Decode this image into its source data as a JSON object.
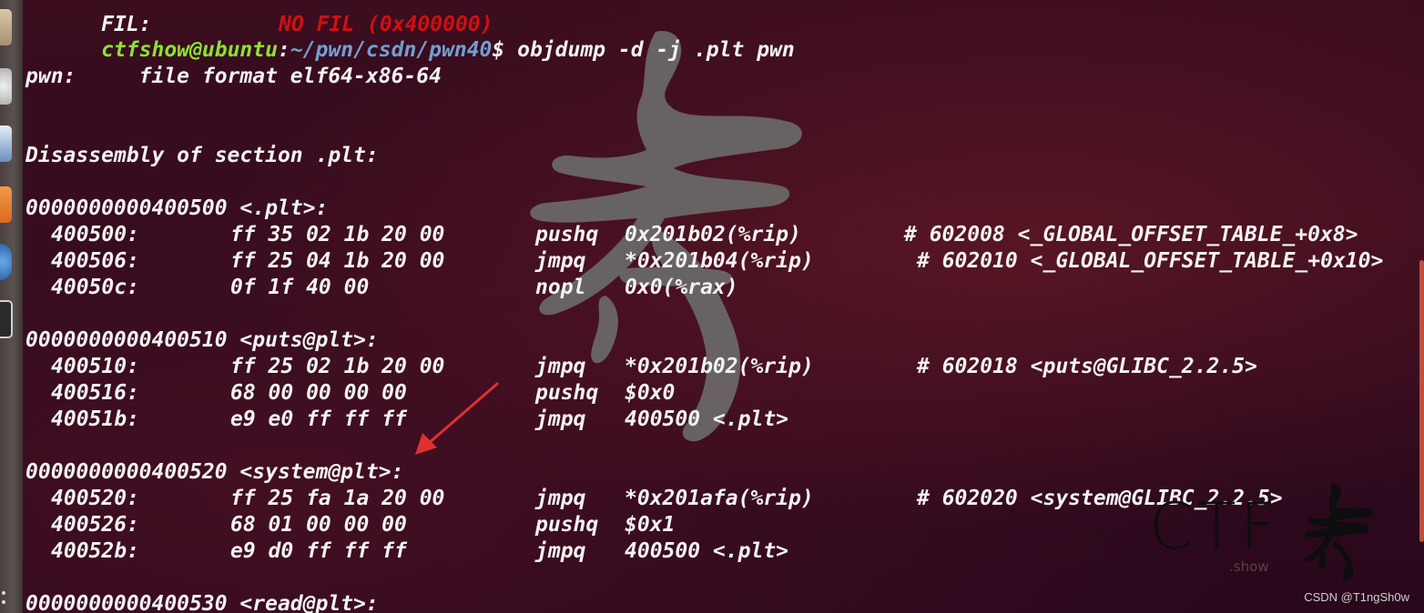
{
  "launcher": {
    "icons": [
      "files-icon",
      "browser-icon",
      "document-icon",
      "software-center-icon",
      "help-icon",
      "terminal-icon"
    ]
  },
  "terminal": {
    "cut_top_line": {
      "label": "FIL:",
      "value": "NO FIL (0x400000)"
    },
    "prompt": {
      "user_host": "ctfshow@ubuntu",
      "separator": ":",
      "path": "~/pwn/csdn/pwn40",
      "symbol": "$",
      "command": " objdump -d -j .plt pwn"
    },
    "file_line": "pwn:     file format elf64-x86-64",
    "section_header": "Disassembly of section .plt:",
    "blocks": [
      {
        "label": "0000000000400500 <.plt>:",
        "rows": [
          {
            "addr": "400500:",
            "bytes": "ff 35 02 1b 20 00",
            "mnemonic": "pushq",
            "operand": "0x201b02(%rip)",
            "comment": "# 602008 <_GLOBAL_OFFSET_TABLE_+0x8>"
          },
          {
            "addr": "400506:",
            "bytes": "ff 25 04 1b 20 00",
            "mnemonic": "jmpq",
            "operand": "*0x201b04(%rip)",
            "comment": "# 602010 <_GLOBAL_OFFSET_TABLE_+0x10>"
          },
          {
            "addr": "40050c:",
            "bytes": "0f 1f 40 00",
            "mnemonic": "nopl",
            "operand": "0x0(%rax)",
            "comment": ""
          }
        ]
      },
      {
        "label": "0000000000400510 <puts@plt>:",
        "rows": [
          {
            "addr": "400510:",
            "bytes": "ff 25 02 1b 20 00",
            "mnemonic": "jmpq",
            "operand": "*0x201b02(%rip)",
            "comment": "# 602018 <puts@GLIBC_2.2.5>"
          },
          {
            "addr": "400516:",
            "bytes": "68 00 00 00 00",
            "mnemonic": "pushq",
            "operand": "$0x0",
            "comment": ""
          },
          {
            "addr": "40051b:",
            "bytes": "e9 e0 ff ff ff",
            "mnemonic": "jmpq",
            "operand": "400500 <.plt>",
            "comment": ""
          }
        ]
      },
      {
        "label": "0000000000400520 <system@plt>:",
        "rows": [
          {
            "addr": "400520:",
            "bytes": "ff 25 fa 1a 20 00",
            "mnemonic": "jmpq",
            "operand": "*0x201afa(%rip)",
            "comment": "# 602020 <system@GLIBC_2.2.5>"
          },
          {
            "addr": "400526:",
            "bytes": "68 01 00 00 00",
            "mnemonic": "pushq",
            "operand": "$0x1",
            "comment": ""
          },
          {
            "addr": "40052b:",
            "bytes": "e9 d0 ff ff ff",
            "mnemonic": "jmpq",
            "operand": "400500 <.plt>",
            "comment": ""
          }
        ]
      },
      {
        "label": "0000000000400530 <read@plt>:",
        "rows": []
      }
    ]
  },
  "logo": {
    "letters": "CTF",
    "sub": ".show"
  },
  "csdn_watermark": "CSDN @T1ngSh0w",
  "colors": {
    "prompt_user": "#8ae234",
    "prompt_path": "#729fcf",
    "text": "#f2f2f2",
    "annotation_arrow": "#e03030"
  }
}
